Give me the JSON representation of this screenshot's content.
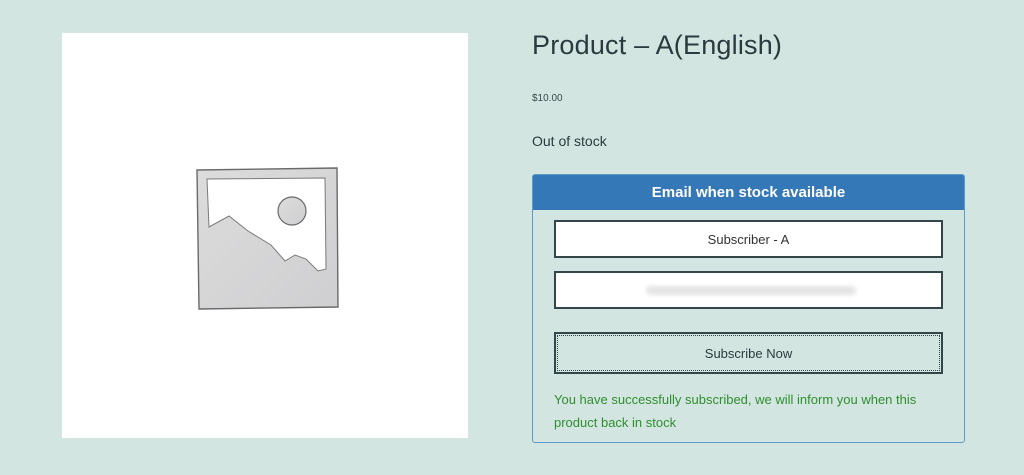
{
  "product": {
    "image_icon": "image-placeholder-icon",
    "title": "Product – A(English)",
    "price": "$10.00",
    "stock_status": "Out of stock"
  },
  "notify_form": {
    "header": "Email when stock available",
    "name_value": "Subscriber - A",
    "email_value": "",
    "button_label": "Subscribe Now",
    "success_message": "You have successfully subscribed, we will inform you when this product back in stock"
  },
  "colors": {
    "background": "#d2e5e0",
    "header": "#3578b8",
    "success": "#2f8f2f",
    "border": "#33474b"
  }
}
